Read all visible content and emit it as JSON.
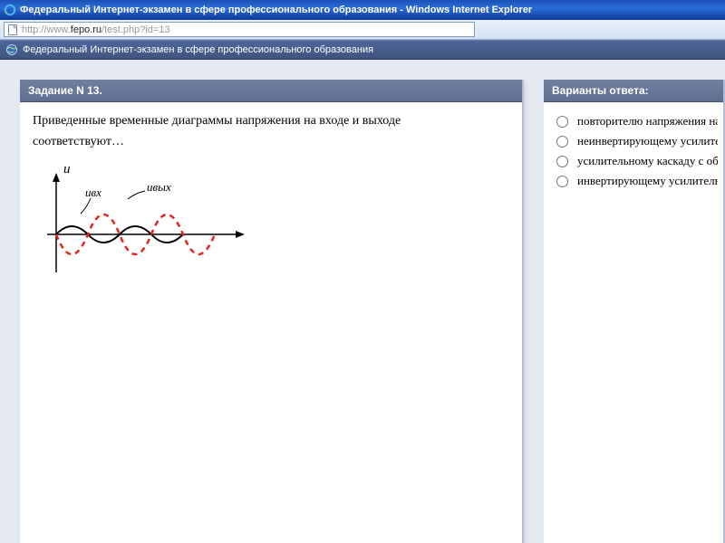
{
  "window": {
    "title": "Федеральный Интернет-экзамен в сфере профессионального образования - Windows Internet Explorer"
  },
  "address": {
    "prefix": "http://www.",
    "host": "fepo.ru",
    "path": "/test.php?id=13"
  },
  "banner": {
    "title": "Федеральный Интернет-экзамен в сфере профессионального образования"
  },
  "task": {
    "header": "Задание N 13.",
    "prompt_line1": "Приведенные временные диаграммы напряжения на входе и выходе",
    "prompt_line2": "соответствуют…",
    "axis_label": "u",
    "signal_in_label": "uвх",
    "signal_out_label": "uвых"
  },
  "answers": {
    "header": "Варианты ответа:",
    "options": [
      "повторителю напряжения на о",
      "неинвертирующему усилител",
      "усилительному каскаду с общ",
      "инвертирующему усилителю"
    ]
  }
}
